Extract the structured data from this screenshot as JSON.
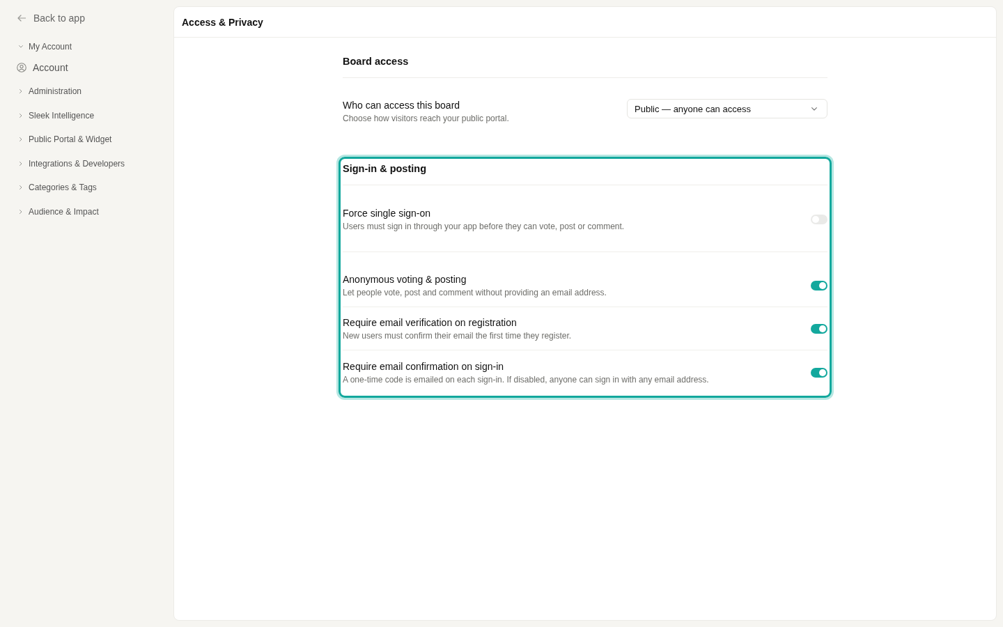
{
  "sidebar": {
    "back_link": {
      "label": "Back to app"
    },
    "groups": [
      {
        "label": "My Account",
        "expanded": true,
        "children": [
          {
            "label": "Account"
          }
        ]
      },
      {
        "label": "Administration",
        "expanded": false
      },
      {
        "label": "Sleek Intelligence",
        "expanded": false
      },
      {
        "label": "Public Portal & Widget",
        "expanded": false
      },
      {
        "label": "Integrations & Developers",
        "expanded": false
      },
      {
        "label": "Categories & Tags",
        "expanded": false
      },
      {
        "label": "Audience & Impact",
        "expanded": false
      }
    ]
  },
  "header": {
    "title": "Access & Privacy"
  },
  "sections": [
    {
      "title": "Board access",
      "highlighted": false,
      "settings": [
        {
          "kind": "select",
          "title": "Who can access this board",
          "description": "Choose how visitors reach your public portal.",
          "value": "Public — anyone can access"
        }
      ]
    },
    {
      "title": "Sign-in & posting",
      "highlighted": true,
      "settings": [
        {
          "kind": "toggle",
          "title": "Force single sign-on",
          "description": "Users must sign in through your app before they can vote, post or comment.",
          "on": false,
          "disabled": true
        },
        {
          "kind": "toggle",
          "title": "Anonymous voting & posting",
          "description": "Let people vote, post and comment without providing an email address.",
          "on": true,
          "disabled": false
        },
        {
          "kind": "toggle",
          "title": "Require email verification on registration",
          "description": "New users must confirm their email the first time they register.",
          "on": true,
          "disabled": false
        },
        {
          "kind": "toggle",
          "title": "Require email confirmation on sign-in",
          "description": "A one-time code is emailed on each sign-in. If disabled, anyone can sign in with any email address.",
          "on": true,
          "disabled": false
        }
      ]
    }
  ]
}
